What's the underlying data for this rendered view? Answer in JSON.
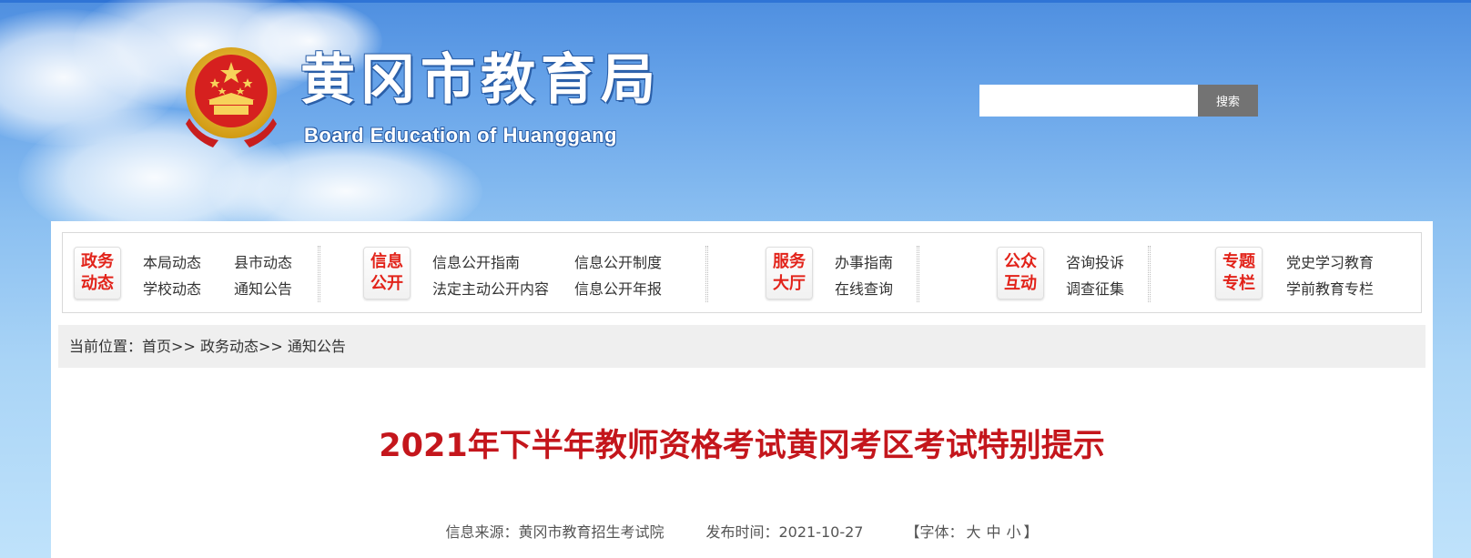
{
  "header": {
    "title": "黄冈市教育局",
    "subtitle": "Board Education of Huanggang",
    "search": {
      "value": "",
      "placeholder": "",
      "button_label": "搜索"
    }
  },
  "nav": {
    "groups": [
      {
        "label_line1": "政务",
        "label_line2": "动态",
        "links": [
          "本局动态",
          "县市动态",
          "学校动态",
          "通知公告"
        ]
      },
      {
        "label_line1": "信息",
        "label_line2": "公开",
        "links": [
          "信息公开指南",
          "信息公开制度",
          "法定主动公开内容",
          "信息公开年报"
        ]
      },
      {
        "label_line1": "服务",
        "label_line2": "大厅",
        "links": [
          "办事指南",
          "在线查询"
        ]
      },
      {
        "label_line1": "公众",
        "label_line2": "互动",
        "links": [
          "咨询投诉",
          "调查征集"
        ]
      },
      {
        "label_line1": "专题",
        "label_line2": "专栏",
        "links": [
          "党史学习教育",
          "学前教育专栏"
        ]
      }
    ]
  },
  "breadcrumb": {
    "prefix": "当前位置：",
    "items": [
      "首页",
      "政务动态",
      "通知公告"
    ],
    "separator": ">>"
  },
  "article": {
    "title": "2021年下半年教师资格考试黄冈考区考试特别提示",
    "source_label": "信息来源：",
    "source": "黄冈市教育招生考试院",
    "date_label": "发布时间：",
    "date": "2021-10-27",
    "font_label_open": "【字体：",
    "font_sizes": [
      "大",
      "中",
      "小"
    ],
    "font_label_close": "】"
  },
  "colors": {
    "accent_red": "#c4161c",
    "nav_icon_red": "#e2231a",
    "sky_top": "#4f8fe0",
    "sky_bottom": "#bfe2fb",
    "search_button": "#737373"
  }
}
